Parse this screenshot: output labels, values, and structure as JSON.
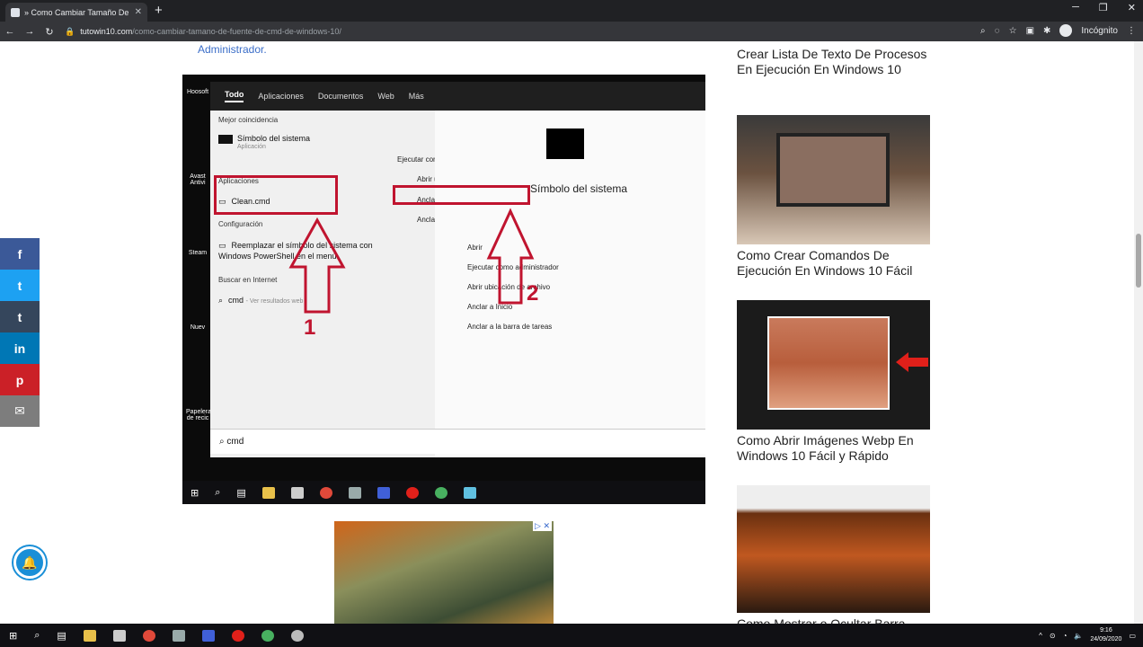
{
  "browser": {
    "tab_title": "» Como Cambiar Tamaño De Fu",
    "url_host": "tutowin10.com",
    "url_path": "/como-cambiar-tamano-de-fuente-de-cmd-de-windows-10/",
    "incognito_label": "Incógnito"
  },
  "article": {
    "admin_link": "Administrador."
  },
  "search_ui": {
    "tabs": [
      "Todo",
      "Aplicaciones",
      "Documentos",
      "Web",
      "Más"
    ],
    "best_match_header": "Mejor coincidencia",
    "best_match_title": "Símbolo del sistema",
    "best_match_sub": "Aplicación",
    "apps_header": "Aplicaciones",
    "app_item": "Clean.cmd",
    "config_header": "Configuración",
    "config_item": "Reemplazar el símbolo del sistema con Windows PowerShell en el menú",
    "web_header": "Buscar en Internet",
    "web_item": "cmd",
    "web_item_sub": "- Ver resultados web",
    "context_menu": [
      "Ejecutar como administrador",
      "Abrir ubicación de archivo",
      "Anclar a Inicio",
      "Anclar a la barra de tareas"
    ],
    "right_title": "Símbolo del sistema",
    "right_actions": [
      "Abrir",
      "Ejecutar como administrador",
      "Abrir ubicación de archivo",
      "Anclar a Inicio",
      "Anclar a la barra de tareas"
    ],
    "search_text": "cmd",
    "step1": "1",
    "step2": "2",
    "desktop_icons": [
      "Hoosoft",
      "Avast Antivi",
      "Steam",
      "Nuev",
      "Papelera de recic"
    ]
  },
  "sidebar": {
    "items": [
      {
        "title": "Crear Lista De Texto De Procesos En Ejecución En Windows 10"
      },
      {
        "title": "Como Crear Comandos De Ejecución En Windows 10 Fácil"
      },
      {
        "title": "Como Abrir Imágenes Webp En Windows 10 Fácil y Rápido"
      },
      {
        "title": "Como Mostrar o Ocultar Barra"
      }
    ]
  },
  "share": {
    "buttons": [
      {
        "icon": "facebook-icon",
        "glyph": "f",
        "color": "#3b5998"
      },
      {
        "icon": "twitter-icon",
        "glyph": "t",
        "color": "#1da1f2"
      },
      {
        "icon": "tumblr-icon",
        "glyph": "t",
        "color": "#35465c"
      },
      {
        "icon": "linkedin-icon",
        "glyph": "in",
        "color": "#0077b5"
      },
      {
        "icon": "pinterest-icon",
        "glyph": "p",
        "color": "#cb2027"
      },
      {
        "icon": "email-icon",
        "glyph": "✉",
        "color": "#7d7d7d"
      }
    ]
  },
  "system": {
    "time": "9:16",
    "date": "24/09/2020"
  },
  "ad": {
    "close_label": "▷ ✕"
  }
}
